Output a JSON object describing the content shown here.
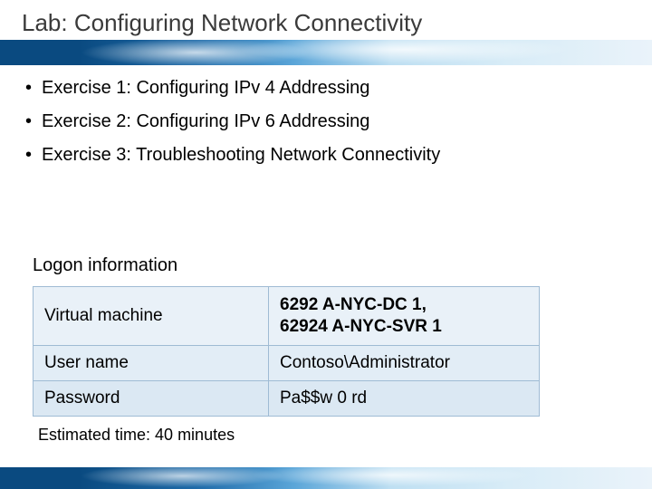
{
  "title": "Lab: Configuring Network Connectivity",
  "bullets": [
    "Exercise 1: Configuring IPv 4 Addressing",
    "Exercise 2: Configuring IPv 6 Addressing",
    "Exercise 3: Troubleshooting Network Connectivity"
  ],
  "logon_heading": "Logon information",
  "table": {
    "rows": [
      {
        "label": "Virtual machine",
        "value": "6292 A-NYC-DC 1,\n62924 A-NYC-SVR 1"
      },
      {
        "label": "User name",
        "value": "Contoso\\Administrator"
      },
      {
        "label": "Password",
        "value": "Pa$$w 0 rd"
      }
    ]
  },
  "estimate": "Estimated time: 40 minutes"
}
